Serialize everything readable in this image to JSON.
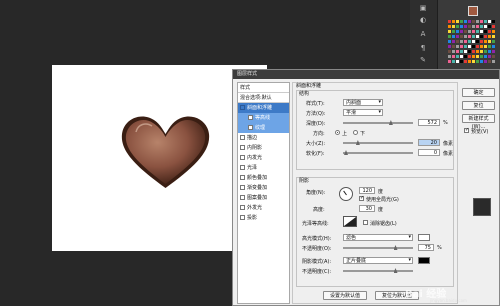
{
  "dialog": {
    "title": "图层样式",
    "styles_header": "样式",
    "blend_default": "混合选项:默认",
    "style_items": [
      {
        "label": "斜面和浮雕",
        "checked": true,
        "selected": true
      },
      {
        "label": "等高线",
        "checked": false,
        "sub": true,
        "sub_selected": true
      },
      {
        "label": "纹理",
        "checked": false,
        "sub": true,
        "sub_selected": true
      },
      {
        "label": "描边",
        "checked": false
      },
      {
        "label": "内阴影",
        "checked": false
      },
      {
        "label": "内发光",
        "checked": false
      },
      {
        "label": "光泽",
        "checked": false
      },
      {
        "label": "颜色叠加",
        "checked": false
      },
      {
        "label": "渐变叠加",
        "checked": false
      },
      {
        "label": "图案叠加",
        "checked": false
      },
      {
        "label": "外发光",
        "checked": false
      },
      {
        "label": "投影",
        "checked": false
      }
    ],
    "bevel": {
      "section_title": "斜面和浮雕",
      "structure_title": "结构",
      "style_label": "样式(T):",
      "style_value": "内斜面",
      "method_label": "方法(Q):",
      "method_value": "平滑",
      "depth_label": "深度(D):",
      "depth_value": "572",
      "depth_unit": "%",
      "depth_fill": 0.68,
      "direction_label": "方向:",
      "direction_up": "上",
      "direction_down": "下",
      "size_label": "大小(Z):",
      "size_value": "20",
      "size_unit": "像素",
      "size_fill": 0.18,
      "soften_label": "软化(F):",
      "soften_value": "0",
      "soften_unit": "像素",
      "soften_fill": 0.0
    },
    "shading": {
      "title": "阴影",
      "angle_label": "角度(N):",
      "angle_value": "120",
      "angle_unit": "度",
      "global_light": "使用全局光(G)",
      "altitude_label": "高度:",
      "altitude_value": "30",
      "altitude_unit": "度",
      "gloss_label": "光泽等高线:",
      "antialias": "消除锯齿(L)",
      "highlight_mode_label": "高光模式(H):",
      "highlight_mode_value": "滤色",
      "highlight_opacity_label": "不透明度(O):",
      "highlight_opacity_value": "75",
      "highlight_opacity_fill": 0.75,
      "highlight_color": "#ffffff",
      "shadow_mode_label": "阴影模式(A):",
      "shadow_mode_value": "正片叠底",
      "shadow_color": "#000000",
      "shadow_opacity_label": "不透明度(C):",
      "shadow_opacity_fill": 0.75,
      "percent": "%"
    },
    "set_default": "设置为默认值",
    "reset_default": "复位为默认值",
    "buttons": {
      "ok": "确定",
      "cancel": "复位",
      "new_style": "新建样式(W)...",
      "preview": "预览(V)"
    }
  },
  "workspace": {
    "heart_color": "#8a5240",
    "watermark": "Bai 经验",
    "watermark_sub": "jingyan.baidu.com"
  }
}
